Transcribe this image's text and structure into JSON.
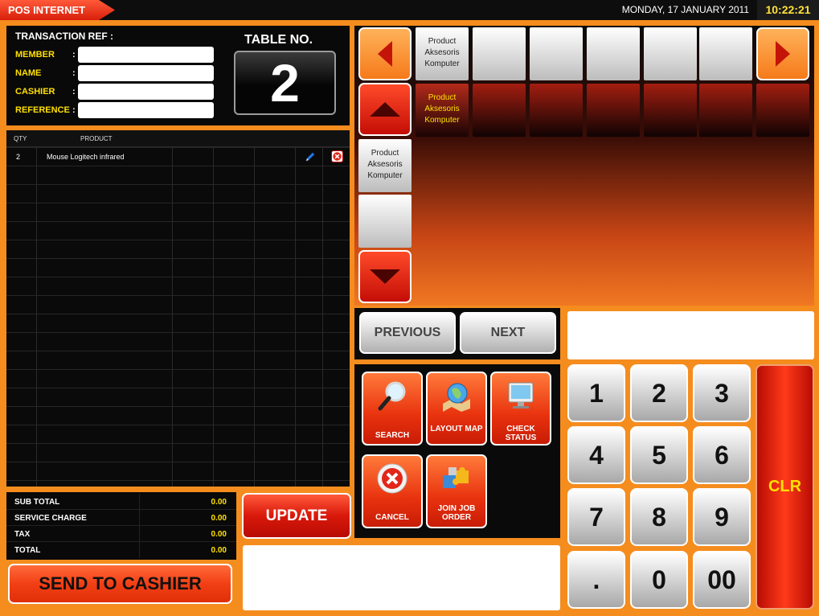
{
  "header": {
    "app_title": "POS INTERNET",
    "date": "MONDAY, 17 JANUARY 2011",
    "time": "10:22:21"
  },
  "transaction": {
    "title": "TRANSACTION REF :",
    "fields": [
      {
        "label": "MEMBER",
        "value": ""
      },
      {
        "label": "NAME",
        "value": ""
      },
      {
        "label": "CASHIER",
        "value": ""
      },
      {
        "label": "REFERENCE",
        "value": ""
      }
    ],
    "colon": ":",
    "table_label": "TABLE NO.",
    "table_number": "2"
  },
  "orders": {
    "columns": [
      "QTY",
      "PRODUCT"
    ],
    "rows": [
      {
        "qty": "2",
        "product": "Mouse Logitech infrared"
      }
    ]
  },
  "totals": [
    {
      "label": "SUB TOTAL",
      "value": "0.00"
    },
    {
      "label": "SERVICE CHARGE",
      "value": "0.00"
    },
    {
      "label": "TAX",
      "value": "0.00"
    },
    {
      "label": "TOTAL",
      "value": "0.00"
    }
  ],
  "buttons": {
    "send": "SEND TO CASHIER",
    "update": "UPDATE",
    "previous": "PREVIOUS",
    "next": "NEXT",
    "clear": "CLR"
  },
  "categories": {
    "tab_tile": "Product Aksesoris Komputer",
    "active_tile": "Product Aksesoris Komputer",
    "side_tile": "Product Aksesoris Komputer"
  },
  "functions": [
    {
      "label": "SEARCH",
      "icon": "magnifier-icon"
    },
    {
      "label": "LAYOUT MAP",
      "icon": "globe-map-icon"
    },
    {
      "label": "CHECK STATUS",
      "icon": "monitor-status-icon"
    },
    {
      "label": "CANCEL",
      "icon": "cancel-x-icon"
    },
    {
      "label": "JOIN JOB ORDER",
      "icon": "puzzle-icon"
    }
  ],
  "keypad": [
    "1",
    "2",
    "3",
    "4",
    "5",
    "6",
    "7",
    "8",
    "9",
    ".",
    "0",
    "00"
  ],
  "colors": {
    "accent_orange": "#f58c1e",
    "alert_red": "#d9180b",
    "label_yellow": "#ffe000"
  }
}
